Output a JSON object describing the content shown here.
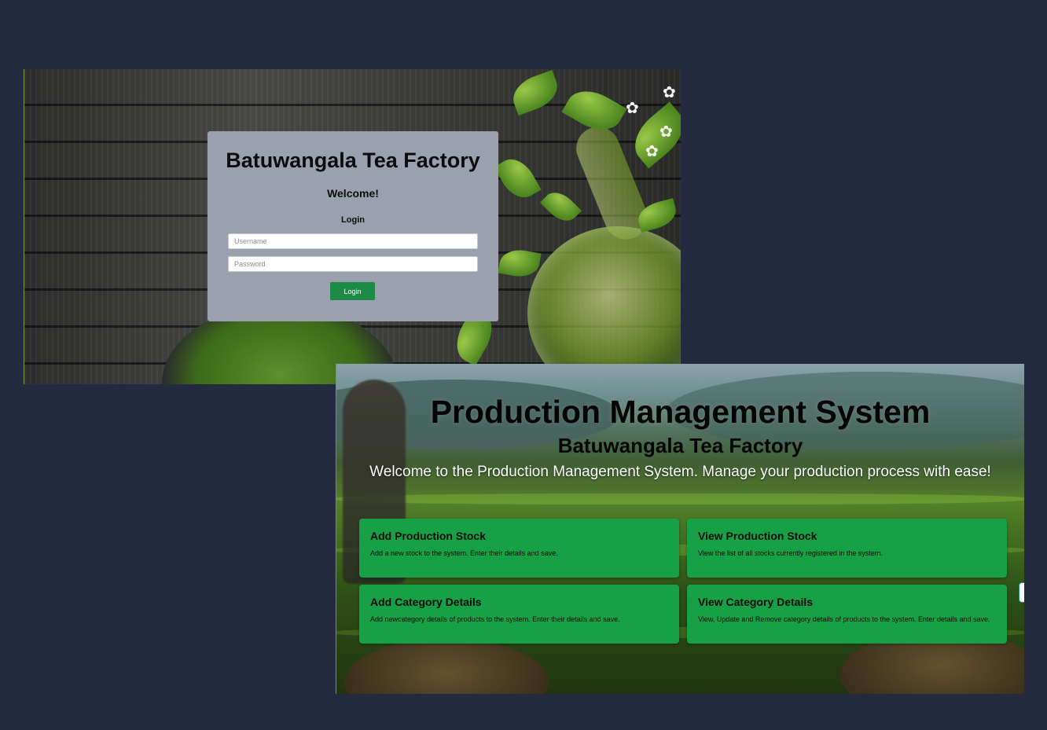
{
  "login": {
    "title": "Batuwangala Tea Factory",
    "welcome": "Welcome!",
    "section_label": "Login",
    "username_placeholder": "Username",
    "password_placeholder": "Password",
    "login_button": "Login"
  },
  "dashboard": {
    "title": "Production Management System",
    "subtitle": "Batuwangala Tea Factory",
    "tagline": "Welcome to the Production Management System. Manage your production process with ease!",
    "cards": [
      {
        "title": "Add Production Stock",
        "description": "Add a new stock to the system. Enter their details and save."
      },
      {
        "title": "View Production Stock",
        "description": "View the list of all stocks currently registered in the system."
      },
      {
        "title": "Add Category Details",
        "description": "Add newcategory details of products to the system. Enter their details and save."
      },
      {
        "title": "View Category Details",
        "description": "View, Update and Remove category details of products to the system. Enter details and save."
      }
    ]
  },
  "colors": {
    "page_background": "#242a3f",
    "login_card": "#9aa0ad",
    "login_button": "#1d8a45",
    "dashboard_card": "#18a047"
  }
}
